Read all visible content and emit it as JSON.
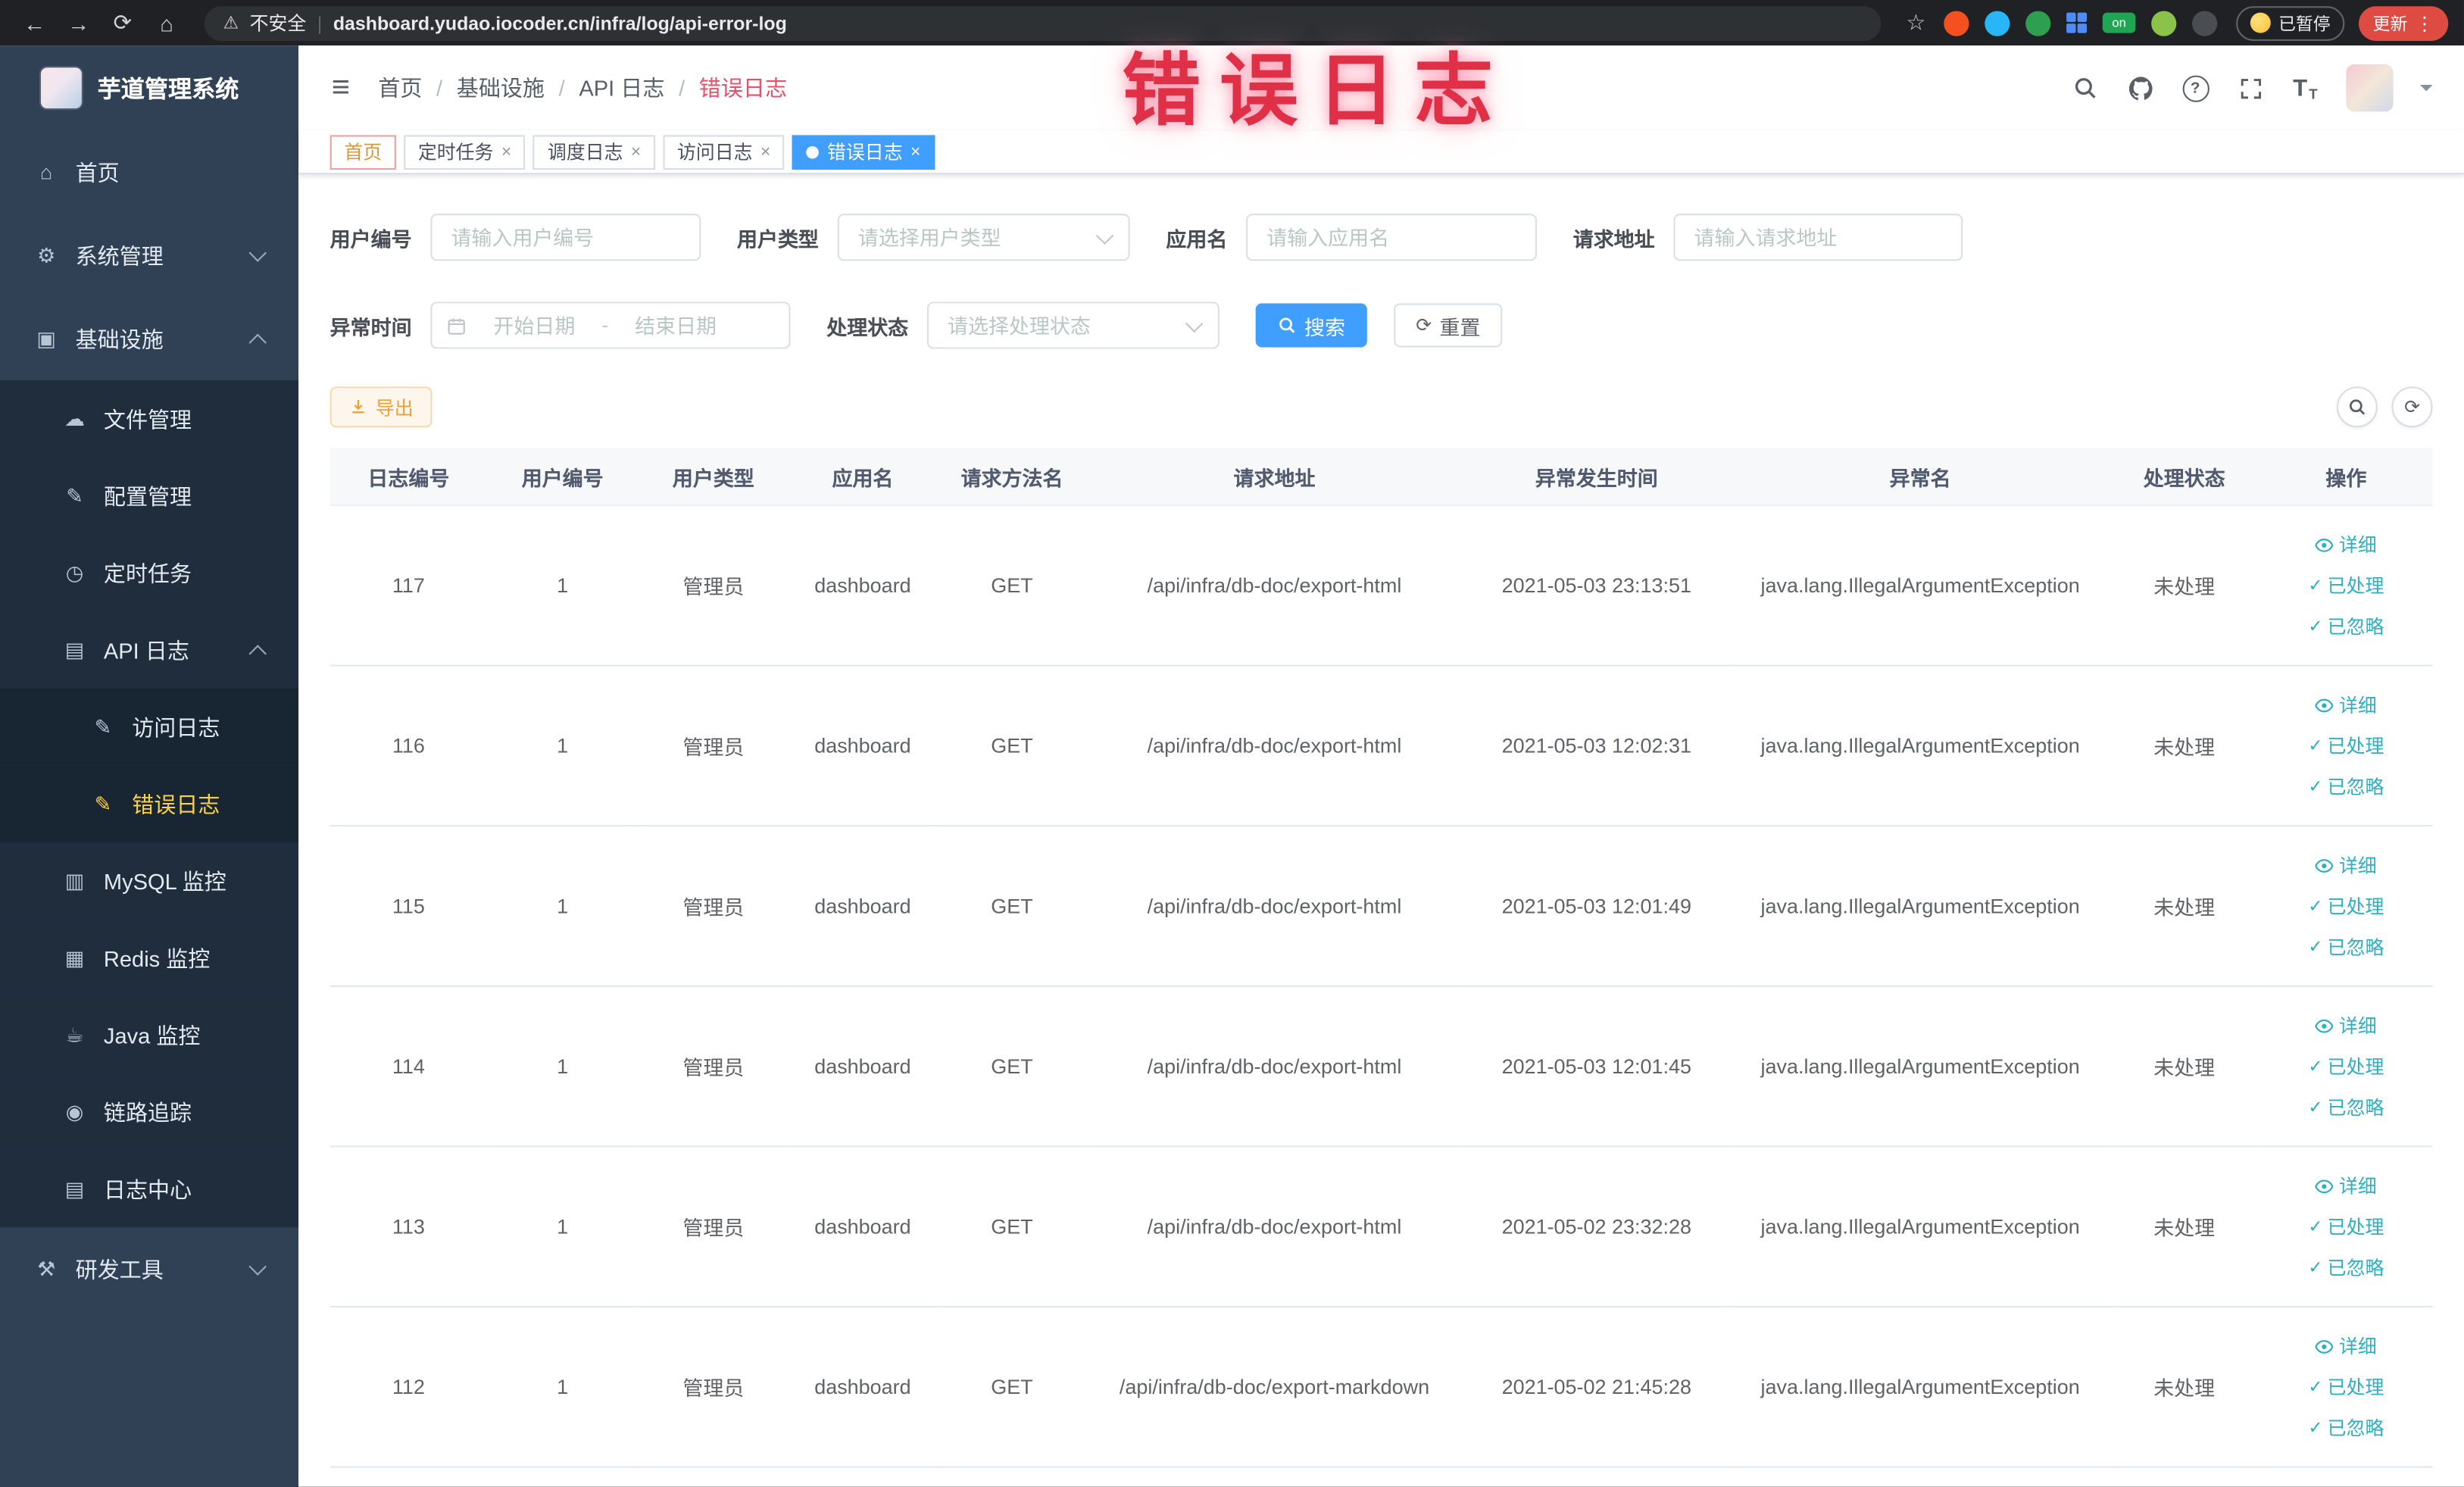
{
  "colors": {
    "primary": "#409eff",
    "sidebar_bg": "#304156",
    "sidebar_submenu_bg": "#1f2d3d",
    "sidebar_active_text": "#ffd04b",
    "tab_active_bg": "#409eff",
    "action_link": "#2eaec1",
    "export_warning": "#e6a23c",
    "watermark_red": "#e03048"
  },
  "icons": {
    "back": "←",
    "forward": "→",
    "reload": "⟳",
    "home": "⌂",
    "warning": "⚠",
    "star": "☆",
    "kebab": "⋮",
    "hamburger": "≡",
    "pipe": "|",
    "slash": "/",
    "close": "×",
    "check": "✓",
    "question": "?",
    "font_size": "T"
  },
  "browser": {
    "security_label": "不安全",
    "url": "dashboard.yudao.iocoder.cn/infra/log/api-error-log",
    "extensions_on_badge": "on",
    "paused_badge": "已暂停",
    "update_button": "更新"
  },
  "sidebar": {
    "logo_title": "芋道管理系统",
    "items": [
      {
        "label": "首页",
        "icon": "⌂"
      },
      {
        "label": "系统管理",
        "icon": "⚙"
      },
      {
        "label": "基础设施",
        "icon": "▣"
      },
      {
        "label": "文件管理",
        "icon": "☁"
      },
      {
        "label": "配置管理",
        "icon": "✎"
      },
      {
        "label": "定时任务",
        "icon": "◷"
      },
      {
        "label": "API 日志",
        "icon": "▤"
      },
      {
        "label": "访问日志",
        "icon": "✎"
      },
      {
        "label": "错误日志",
        "icon": "✎"
      },
      {
        "label": "MySQL 监控",
        "icon": "▥"
      },
      {
        "label": "Redis 监控",
        "icon": "▦"
      },
      {
        "label": "Java 监控",
        "icon": "☕"
      },
      {
        "label": "链路追踪",
        "icon": "◉"
      },
      {
        "label": "日志中心",
        "icon": "▤"
      },
      {
        "label": "研发工具",
        "icon": "⚒"
      }
    ]
  },
  "header": {
    "breadcrumb": [
      {
        "label": "首页"
      },
      {
        "label": "基础设施"
      },
      {
        "label": "API 日志"
      },
      {
        "label": "错误日志"
      }
    ]
  },
  "tabs": [
    {
      "label": "首页"
    },
    {
      "label": "定时任务"
    },
    {
      "label": "调度日志"
    },
    {
      "label": "访问日志"
    },
    {
      "label": "错误日志"
    }
  ],
  "watermark": "错误日志",
  "filters": {
    "user_id_label": "用户编号",
    "user_id_placeholder": "请输入用户编号",
    "user_type_label": "用户类型",
    "user_type_placeholder": "请选择用户类型",
    "app_name_label": "应用名",
    "app_name_placeholder": "请输入应用名",
    "request_url_label": "请求地址",
    "request_url_placeholder": "请输入请求地址",
    "exception_time_label": "异常时间",
    "date_start_placeholder": "开始日期",
    "date_end_placeholder": "结束日期",
    "date_separator": "-",
    "status_label": "处理状态",
    "status_placeholder": "请选择处理状态",
    "search_button": "搜索",
    "reset_button": "重置"
  },
  "toolbar": {
    "export_button": "导出"
  },
  "table": {
    "columns": [
      "日志编号",
      "用户编号",
      "用户类型",
      "应用名",
      "请求方法名",
      "请求地址",
      "异常发生时间",
      "异常名",
      "处理状态",
      "操作"
    ],
    "action_detail": "详细",
    "action_processed": "已处理",
    "action_ignored": "已忽略",
    "rows": [
      {
        "log_id": "117",
        "user_id": "1",
        "user_type": "管理员",
        "app_name": "dashboard",
        "method": "GET",
        "request_url": "/api/infra/db-doc/export-html",
        "time": "2021-05-03 23:13:51",
        "exception": "java.lang.IllegalArgumentException",
        "status": "未处理"
      },
      {
        "log_id": "116",
        "user_id": "1",
        "user_type": "管理员",
        "app_name": "dashboard",
        "method": "GET",
        "request_url": "/api/infra/db-doc/export-html",
        "time": "2021-05-03 12:02:31",
        "exception": "java.lang.IllegalArgumentException",
        "status": "未处理"
      },
      {
        "log_id": "115",
        "user_id": "1",
        "user_type": "管理员",
        "app_name": "dashboard",
        "method": "GET",
        "request_url": "/api/infra/db-doc/export-html",
        "time": "2021-05-03 12:01:49",
        "exception": "java.lang.IllegalArgumentException",
        "status": "未处理"
      },
      {
        "log_id": "114",
        "user_id": "1",
        "user_type": "管理员",
        "app_name": "dashboard",
        "method": "GET",
        "request_url": "/api/infra/db-doc/export-html",
        "time": "2021-05-03 12:01:45",
        "exception": "java.lang.IllegalArgumentException",
        "status": "未处理"
      },
      {
        "log_id": "113",
        "user_id": "1",
        "user_type": "管理员",
        "app_name": "dashboard",
        "method": "GET",
        "request_url": "/api/infra/db-doc/export-html",
        "time": "2021-05-02 23:32:28",
        "exception": "java.lang.IllegalArgumentException",
        "status": "未处理"
      },
      {
        "log_id": "112",
        "user_id": "1",
        "user_type": "管理员",
        "app_name": "dashboard",
        "method": "GET",
        "request_url": "/api/infra/db-doc/export-markdown",
        "time": "2021-05-02 21:45:28",
        "exception": "java.lang.IllegalArgumentException",
        "status": "未处理"
      }
    ]
  }
}
